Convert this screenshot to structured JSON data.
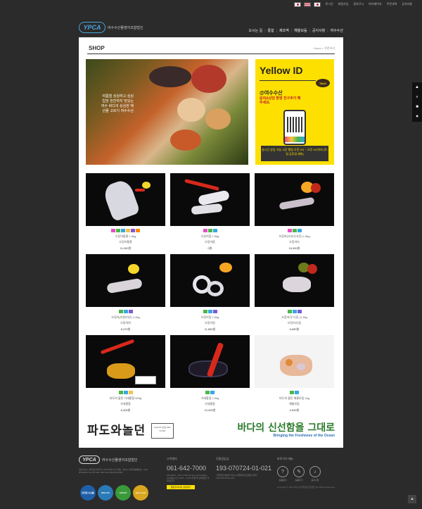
{
  "topbar": {
    "links": [
      "로그인",
      "회원가입",
      "장바구니",
      "마이페이지",
      "주문내역",
      "공지사항"
    ]
  },
  "header": {
    "logo_mark": "YPCA",
    "logo_text": "여수수산물영어조합법인",
    "nav": [
      "오시는 길",
      "통합",
      "제조역",
      "해물모듬",
      "공지사항",
      "여수수산"
    ]
  },
  "page": {
    "title": "SHOP",
    "breadcrumb": "Home > 주문하기"
  },
  "banner": {
    "text": "여름철 싱싱하고 싱싱 입맛 한잔까지 맛있는 여수 바다의 싱싱한 해산물 고르기 여수수산"
  },
  "yellow_id": {
    "title": "Yellow ID",
    "talk": "TALK",
    "account": "@여수수산",
    "message": "문의&상담 환영 친구추가 해주세요.",
    "hours": "실시간 상담 가능 시간 평일 오전 9시 ~ 오후 5시까지 (토,일,공휴일 제외)"
  },
  "products": [
    {
      "name": "오징어통찰 1.0kg",
      "sub": "오징어통찰",
      "price": "11,090원"
    },
    {
      "name": "오징어몸 1.0kg",
      "sub": "오징어몸",
      "price": "0원"
    },
    {
      "name": "오징어(다리/무사진) 1.0kg",
      "sub": "오징어다",
      "price": "16,900원"
    },
    {
      "name": "오징어(키칼/미산) 1.0kg",
      "sub": "오징어여",
      "price": "8,470원"
    },
    {
      "name": "오징어링 1.0kg",
      "sub": "오징어링",
      "price": "11,850원"
    },
    {
      "name": "오징어/무 다듬 (1.2kg",
      "sub": "오징어/다듬",
      "price": "6,650원"
    },
    {
      "name": "피도의 불린 가새홍합 500g",
      "sub": "가새홍합",
      "price": "6,400원"
    },
    {
      "name": "가새홍합 1.0kg",
      "sub": "가새홍합",
      "price": "10,000원"
    },
    {
      "name": "피도의 불린 해물모둠 1kg",
      "sub": "해물모둠",
      "price": "9,500원"
    }
  ],
  "bottom": {
    "left_brand": "파도와놀던",
    "left_badge": "HACCP 인증 SEA FOOD",
    "right_brand": "바다의 신선함을 그대로",
    "right_sub": "Bringing the Freshness of the Ocean"
  },
  "footer": {
    "logo_mark": "YPCA",
    "logo_text": "여수수산물영어조합법인",
    "address": "전남 여수시 돌산읍 우두리 YPCA 여수수산 대표 : 김OO 사업자등록번호 : 000-00-00000 Tel 061-642-7000 Fax 061-000-0000",
    "certs": [
      "안전한 수산물",
      "DEG-KU",
      "HACCP",
      "Rice Food"
    ],
    "col1_title": "고객센터",
    "col1_phone": "061-642-7000",
    "col1_hours": "AM 09:00 ~ PM 17:00 Sat Sun and Holiday Off 점심시간 12:00 ~ 13:00 주말 및 공휴일은 휴무입니다.",
    "col1_btn": "옐로우아이디 상담하기",
    "col2_title": "무통장입금",
    "col2_account": "193-070724-01-021",
    "col2_info": "기업은행 예금주:여수수산물영어조합법인 계좌 : 193-070724-01-021",
    "col3_title": "바로가기 메뉴",
    "col3_items": [
      "상품문의",
      "상품후기",
      "공지사항"
    ],
    "copyright": "Copyright © 2016 여수수산물영어조합법인 All Rights Reserved."
  }
}
